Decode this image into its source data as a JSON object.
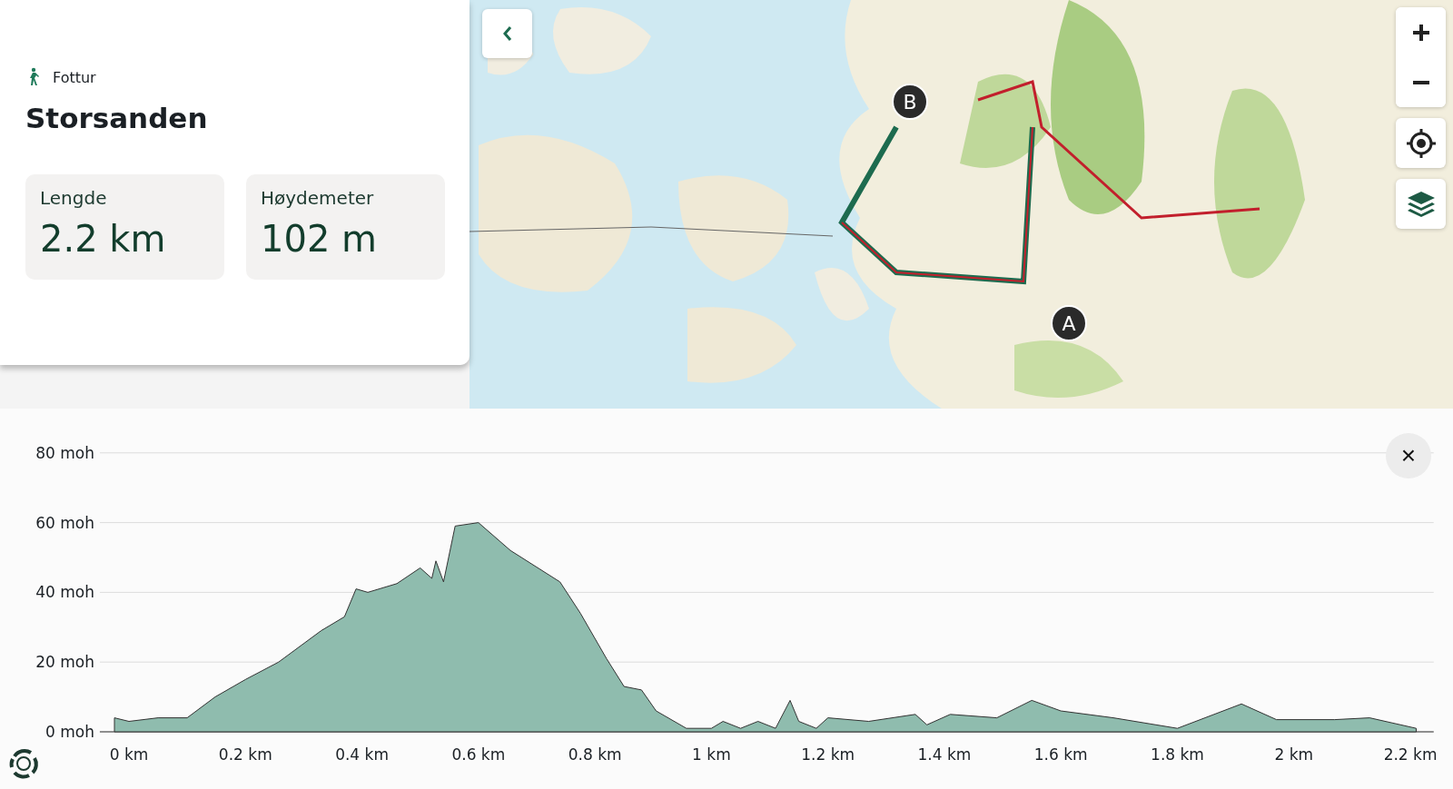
{
  "info_panel": {
    "activity": "Fottur",
    "title": "Storsanden",
    "stats": [
      {
        "label": "Lengde",
        "value": "2.2 km"
      },
      {
        "label": "Høydemeter",
        "value": "102 m"
      }
    ]
  },
  "map": {
    "markers": [
      {
        "label": "B"
      },
      {
        "label": "A"
      }
    ]
  },
  "elevation_profile": {
    "chart_data": {
      "type": "area",
      "x": [
        -0.025,
        0,
        0.05,
        0.1,
        0.148,
        0.2,
        0.257,
        0.33,
        0.37,
        0.39,
        0.41,
        0.46,
        0.5,
        0.52,
        0.527,
        0.54,
        0.56,
        0.6,
        0.655,
        0.74,
        0.775,
        0.82,
        0.85,
        0.88,
        0.905,
        0.957,
        1.0,
        1.02,
        1.05,
        1.08,
        1.11,
        1.135,
        1.15,
        1.18,
        1.2,
        1.27,
        1.35,
        1.37,
        1.41,
        1.49,
        1.55,
        1.6,
        1.69,
        1.8,
        1.91,
        1.97,
        2.07,
        2.13,
        2.21
      ],
      "series": [
        {
          "color": "#8fbcae",
          "values": [
            4,
            3,
            4,
            4,
            10,
            15,
            20,
            29,
            33,
            41,
            40,
            42.5,
            47,
            44,
            49,
            43,
            59,
            60,
            52,
            43,
            34,
            21,
            13,
            12,
            6,
            1,
            1,
            3,
            1,
            3,
            1,
            9,
            3,
            1,
            4,
            3,
            5,
            2,
            5,
            4,
            9,
            6,
            4,
            1,
            8,
            3.5,
            3.5,
            4,
            1
          ]
        }
      ],
      "xlim": [
        -0.05,
        2.24
      ],
      "ylim": [
        0,
        80
      ],
      "grid": true,
      "xticks": [
        {
          "value": 0,
          "label": "0 km"
        },
        {
          "value": 0.2,
          "label": "0.2 km"
        },
        {
          "value": 0.4,
          "label": "0.4 km"
        },
        {
          "value": 0.6,
          "label": "0.6 km"
        },
        {
          "value": 0.8,
          "label": "0.8 km"
        },
        {
          "value": 1,
          "label": "1 km"
        },
        {
          "value": 1.2,
          "label": "1.2 km"
        },
        {
          "value": 1.4,
          "label": "1.4 km"
        },
        {
          "value": 1.6,
          "label": "1.6 km"
        },
        {
          "value": 1.8,
          "label": "1.8 km"
        },
        {
          "value": 2,
          "label": "2 km"
        },
        {
          "value": 2.2,
          "label": "2.2 km"
        }
      ],
      "yticks": [
        {
          "value": 0,
          "label": "0 moh"
        },
        {
          "value": 20,
          "label": "20 moh"
        },
        {
          "value": 40,
          "label": "40 moh"
        },
        {
          "value": 60,
          "label": "60 moh"
        },
        {
          "value": 80,
          "label": "80 moh"
        }
      ]
    },
    "close_symbol": "×"
  }
}
